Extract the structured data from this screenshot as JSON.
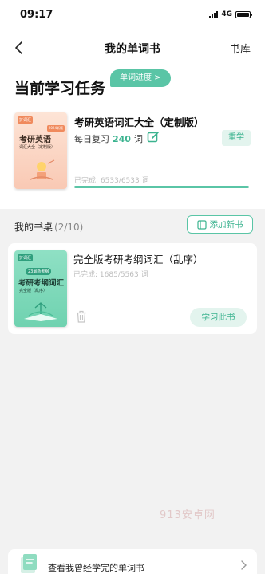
{
  "status": {
    "time": "09:17",
    "network": "4G"
  },
  "nav": {
    "title": "我的单词书",
    "right_label": "书库"
  },
  "current_task": {
    "section_title": "当前学习任务",
    "progress_pill": "单词进度 >",
    "book": {
      "name": "考研英语词汇大全（定制版）",
      "daily_label": "每日复习",
      "daily_count": "240",
      "daily_unit": "词",
      "relearn_label": "重学",
      "completed_text": "已完成: 6533/6533 词",
      "completed_fraction": 1.0,
      "cover": {
        "tag": "扩词汇",
        "tag2": "2024新版",
        "title": "考研英语",
        "subtitle": "词汇大全（定制版）"
      }
    }
  },
  "desk": {
    "title": "我的书桌",
    "count": "(2/10)",
    "add_button": "添加新书",
    "books": [
      {
        "name": "完全版考研考纲词汇（乱序）",
        "completed_text": "已完成: 1685/5563 词",
        "study_button": "学习此书",
        "cover": {
          "tag": "扩词汇",
          "tag2": "23最新考纲",
          "title": "考研考纲词汇",
          "subtitle": "完全版（乱序）"
        }
      }
    ]
  },
  "watermark": "913安卓网",
  "bottom_bar": {
    "label": "查看我曾经学完的单词书"
  },
  "colors": {
    "accent": "#5ac5a6",
    "accent_text": "#3bb38f",
    "accent_light": "#e3f4ee"
  }
}
